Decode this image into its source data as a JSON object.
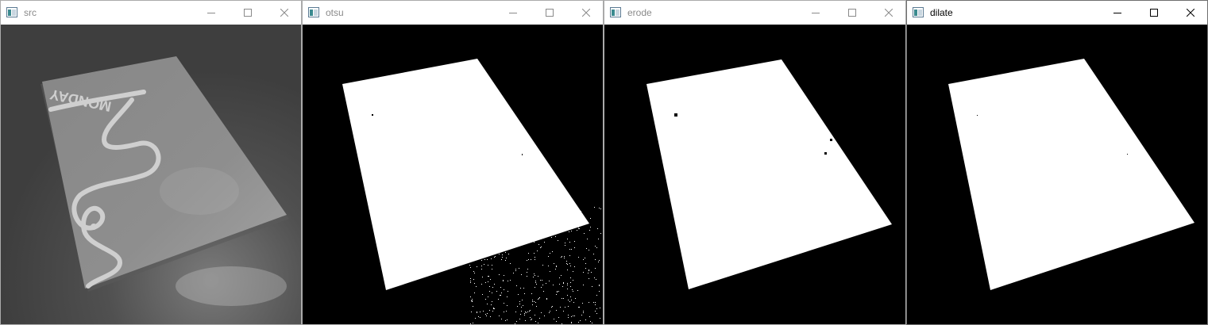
{
  "windows": [
    {
      "id": "src",
      "title": "src",
      "active": false,
      "icon": "opencv-window-icon"
    },
    {
      "id": "otsu",
      "title": "otsu",
      "active": false,
      "icon": "opencv-window-icon"
    },
    {
      "id": "erode",
      "title": "erode",
      "active": false,
      "icon": "opencv-window-icon"
    },
    {
      "id": "dilate",
      "title": "dilate",
      "active": true,
      "icon": "opencv-window-icon"
    }
  ],
  "controls": {
    "minimize_icon": "minimize-icon",
    "maximize_icon": "maximize-icon",
    "close_icon": "close-icon"
  },
  "src_image": {
    "card_text": "MONDAY",
    "background_color": "#4a4a4a",
    "card_color": "#8e8e8e",
    "card_line_color": "#cfcfcf"
  },
  "colors": {
    "mask_background": "#000000",
    "mask_foreground": "#ffffff",
    "inactive_title": "#8a8a8a",
    "active_title": "#000000"
  }
}
